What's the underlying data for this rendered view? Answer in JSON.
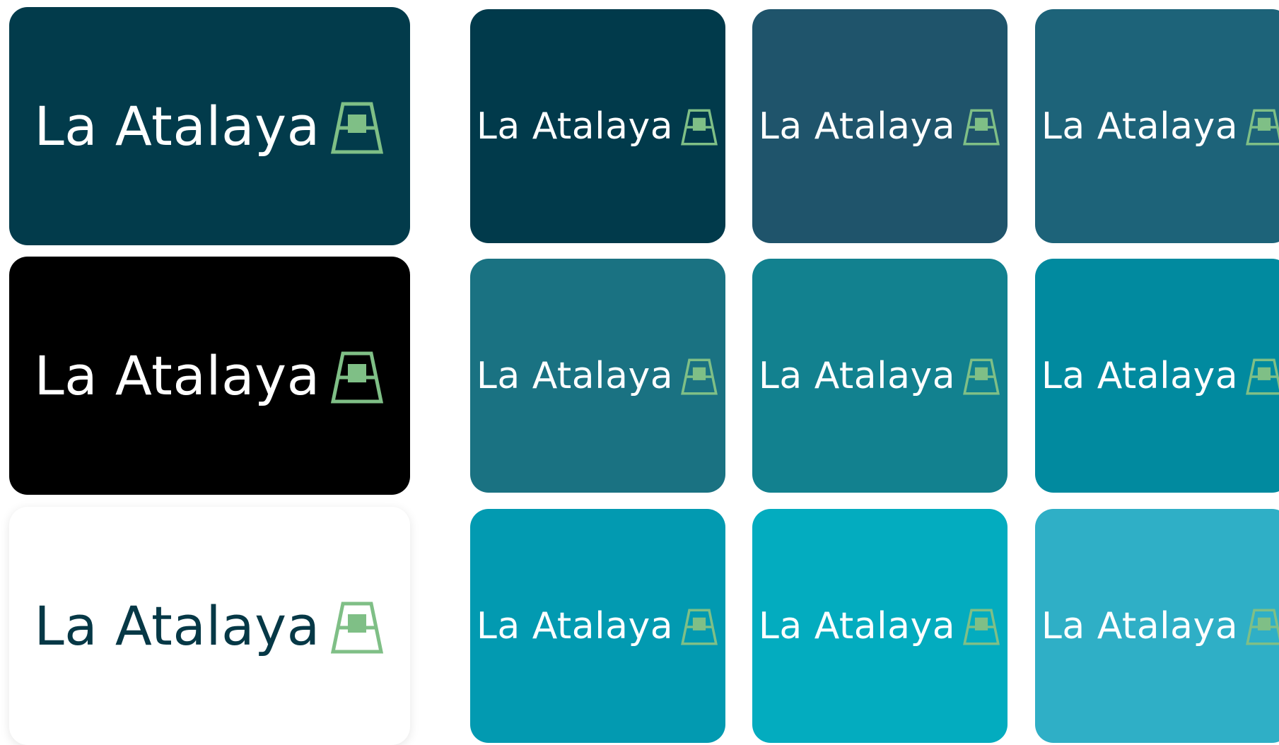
{
  "brand": {
    "name": "La Atalaya",
    "mark_icon": "watchtower-icon",
    "mark_color": "#7fbf86"
  },
  "colors": {
    "white_text": "#ffffff",
    "navy_text": "#063846"
  },
  "primary_cards": [
    {
      "bg": "#023b4b",
      "text_color": "#ffffff"
    },
    {
      "bg": "#000000",
      "text_color": "#ffffff"
    },
    {
      "bg": "#ffffff",
      "text_color": "#063846"
    }
  ],
  "palette_cards": [
    {
      "bg": "#013a4b"
    },
    {
      "bg": "#1f546b"
    },
    {
      "bg": "#1d6379"
    },
    {
      "bg": "#1a7282"
    },
    {
      "bg": "#12818f"
    },
    {
      "bg": "#018a9f"
    },
    {
      "bg": "#029ab1"
    },
    {
      "bg": "#03acbf"
    },
    {
      "bg": "#2fafc6"
    }
  ]
}
